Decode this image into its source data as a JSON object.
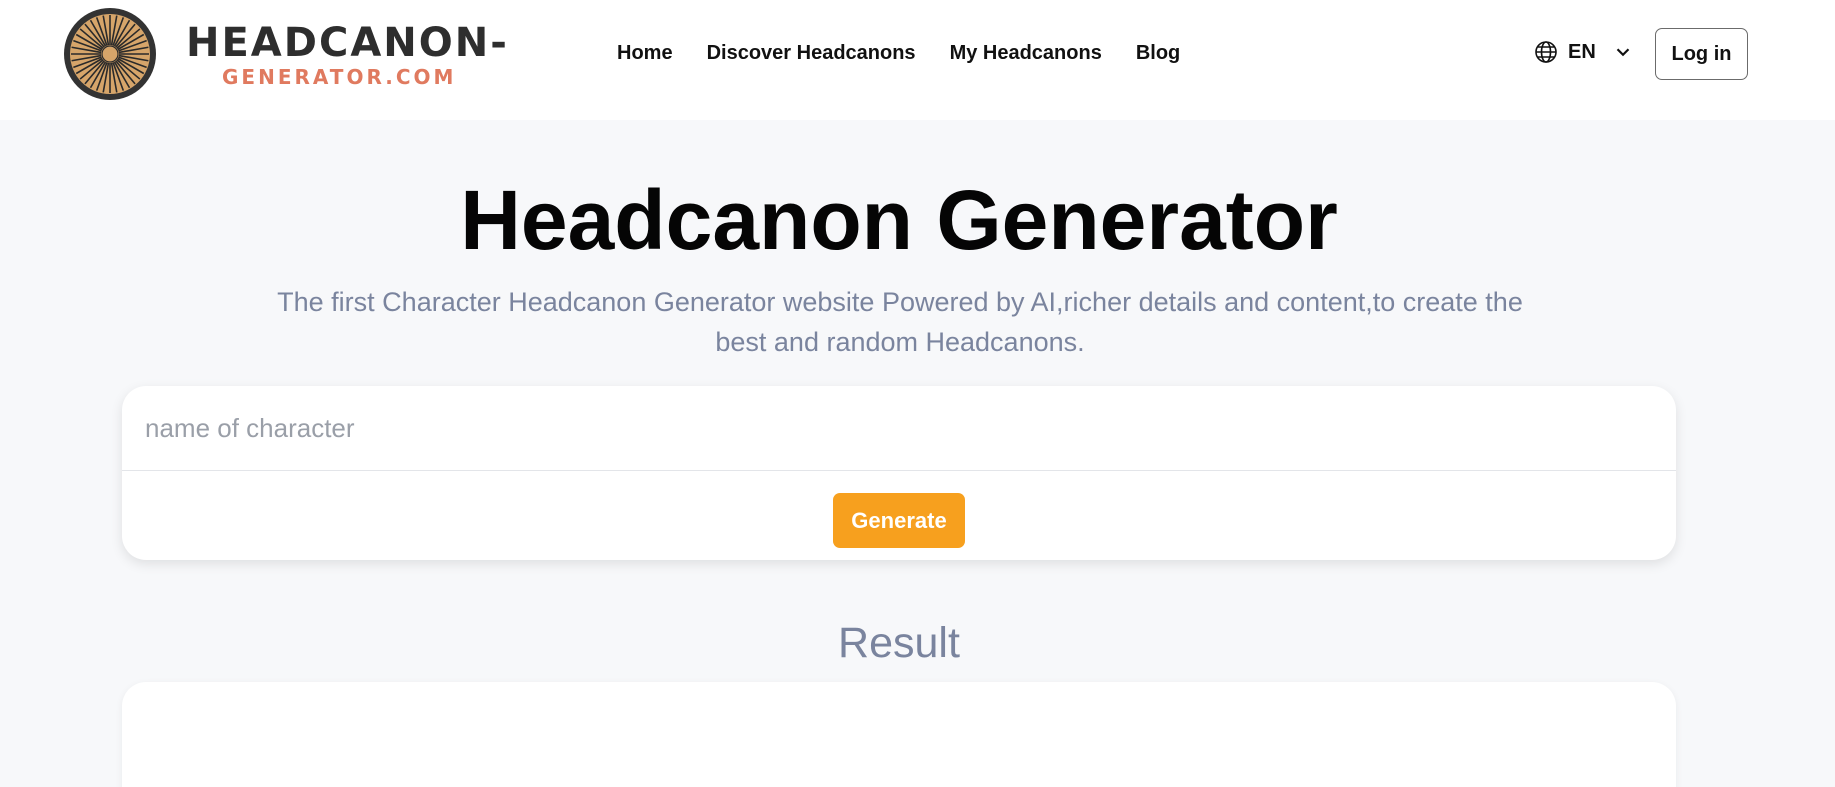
{
  "header": {
    "logo": {
      "line1": "HEADCANON-",
      "line2": "GENERATOR.COM",
      "icon": "sunburst-logo-icon"
    },
    "nav": [
      {
        "label": "Home"
      },
      {
        "label": "Discover Headcanons"
      },
      {
        "label": "My Headcanons"
      },
      {
        "label": "Blog"
      }
    ],
    "language": {
      "label": "EN",
      "icon": "globe-icon",
      "dropdown_icon": "chevron-down-icon"
    },
    "login_label": "Log in"
  },
  "hero": {
    "title": "Headcanon Generator",
    "subtitle": "The first Character Headcanon Generator website Powered by AI,richer details and content,to create the best and random Headcanons."
  },
  "generator": {
    "input_placeholder": "name of character",
    "input_value": "",
    "button_label": "Generate"
  },
  "result": {
    "title": "Result",
    "content": ""
  },
  "colors": {
    "accent": "#f7a01e",
    "logo_orange": "#e07a5f",
    "muted_text": "#7a849e",
    "background": "#f7f8fa"
  }
}
